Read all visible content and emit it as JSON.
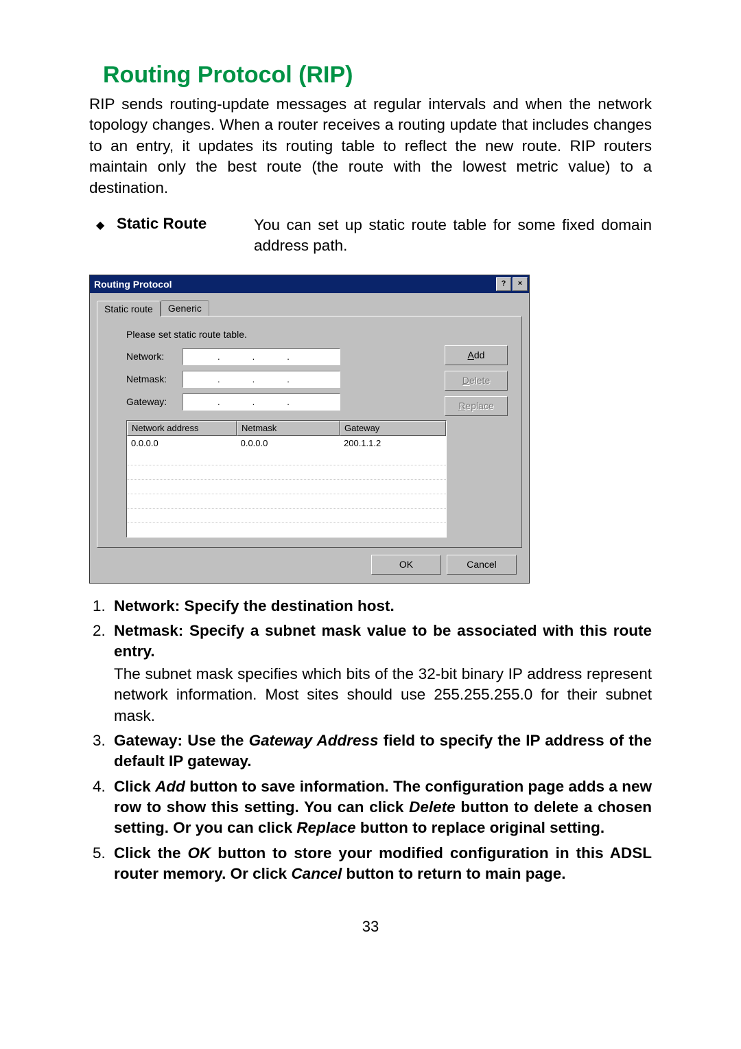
{
  "heading": "Routing Protocol (RIP)",
  "intro": "RIP sends routing-update messages at regular intervals and when the network topology changes. When a router receives a routing update that includes changes to an entry, it updates its routing table to reflect the new route. RIP routers maintain only the best route (the route with the lowest metric value) to a destination.",
  "bullet": {
    "marker": "◆",
    "label": "Static Route",
    "desc": "You can set up static route table for some fixed domain address path."
  },
  "dialog": {
    "title": "Routing Protocol",
    "help_glyph": "?",
    "close_glyph": "×",
    "tabs": {
      "static": "Static route",
      "generic": "Generic"
    },
    "instr": "Please set static route table.",
    "fields": {
      "network_label": "Network:",
      "netmask_label": "Netmask:",
      "gateway_label": "Gateway:"
    },
    "buttons": {
      "add": "Add",
      "delete": "Delete",
      "replace": "Replace",
      "ok": "OK",
      "cancel": "Cancel"
    },
    "table": {
      "headers": [
        "Network address",
        "Netmask",
        "Gateway"
      ],
      "rows": [
        [
          "0.0.0.0",
          "0.0.0.0",
          "200.1.1.2"
        ]
      ]
    }
  },
  "steps": {
    "s1": "Network: Specify the destination host.",
    "s2a": "Netmask: Specify a subnet mask value to be associated with this route entry.",
    "s2b": "The subnet mask specifies which bits of the 32-bit binary IP address represent network information. Most sites should use 255.255.255.0 for their subnet mask.",
    "s3a": "Gateway: Use the ",
    "s3b": "Gateway Address",
    "s3c": " field to specify the IP address of the default IP gateway.",
    "s4a": "Click ",
    "s4b": "Add",
    "s4c": " button to save information.  The configuration page adds a new row to show this setting.  You can click ",
    "s4d": "Delete",
    "s4e": " button to delete a chosen setting.  Or you can click ",
    "s4f": "Replace",
    "s4g": " button to replace original setting.",
    "s5a": "Click the ",
    "s5b": "OK",
    "s5c": " button to store your modified configuration in this ADSL router memory.  Or click ",
    "s5d": "Cancel",
    "s5e": " button to return to main page."
  },
  "page_number": "33",
  "add_underline": "A",
  "add_rest": "dd",
  "delete_underline": "D",
  "delete_rest": "elete",
  "replace_underline": "R",
  "replace_rest": "eplace"
}
